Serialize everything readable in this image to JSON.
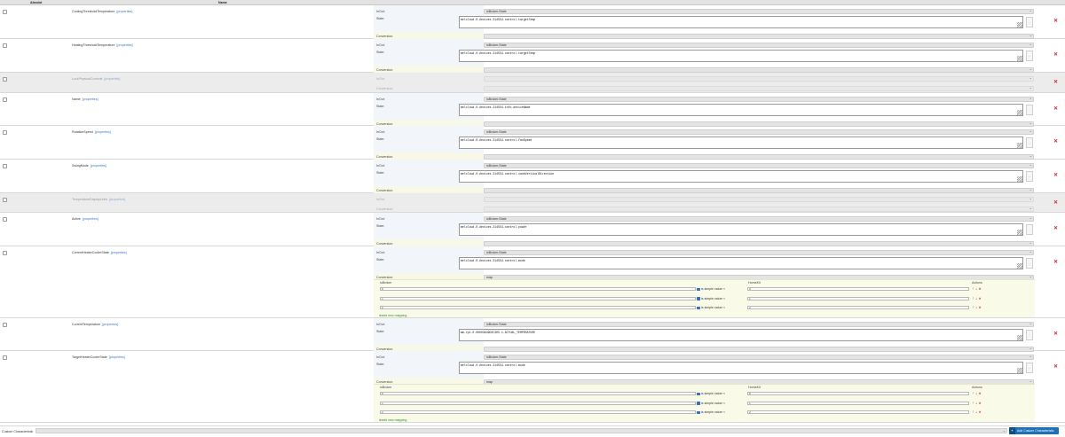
{
  "header": {
    "col_absolute": "Absolut",
    "col_name": "Name"
  },
  "labels": {
    "inout": "InOut:",
    "state": "State:",
    "conversion": "Conversion:",
    "properties_link": "[properties]"
  },
  "options": {
    "iobroker_state": "ioBroker.State",
    "map": "map"
  },
  "rows": [
    {
      "name": "CoolingThresholdTemperature",
      "disabled": false,
      "inout": "ioBroker.State",
      "state": "melcloud.0.devices.214554.control.targetTemp",
      "conversion": ""
    },
    {
      "name": "HeatingThresholdTemperature",
      "disabled": false,
      "inout": "ioBroker.State",
      "state": "melcloud.0.devices.214554.control.targetTemp",
      "conversion": ""
    },
    {
      "name": "LockPhysicalControls",
      "disabled": true,
      "inout": "",
      "state": null,
      "conversion": ""
    },
    {
      "name": "Name",
      "disabled": false,
      "inout": "ioBroker.State",
      "state": "melcloud.0.devices.214554.info.deviceName",
      "conversion": ""
    },
    {
      "name": "RotationSpeed",
      "disabled": false,
      "inout": "ioBroker.State",
      "state": "melcloud.0.devices.214554.control.fanSpeed",
      "conversion": ""
    },
    {
      "name": "SwingMode",
      "disabled": false,
      "inout": "ioBroker.State",
      "state": "melcloud.0.devices.214554.control.vaneVerticalDirection",
      "conversion": ""
    },
    {
      "name": "TemperatureDisplayUnits",
      "disabled": true,
      "inout": "",
      "state": null,
      "conversion": ""
    },
    {
      "name": "Active",
      "disabled": false,
      "inout": "ioBroker.State",
      "state": "melcloud.0.devices.214554.control.power",
      "conversion": ""
    },
    {
      "name": "CurrentHeaterCoolerState",
      "disabled": false,
      "inout": "ioBroker.State",
      "state": "melcloud.0.devices.214554.control.mode",
      "conversion": "map",
      "mapping": {
        "iobroker_head": "ioBroker",
        "homekit_head": "HomeKit",
        "actions_head": "Actions",
        "simple_label": "is simple value",
        "arrow": "⇒",
        "add_label": "add new mapping",
        "entries": [
          {
            "io": "0",
            "hk": "0"
          },
          {
            "io": "1",
            "hk": "1"
          },
          {
            "io": "2",
            "hk": "2"
          }
        ]
      }
    },
    {
      "name": "CurrentTemperature",
      "disabled": false,
      "inout": "ioBroker.State",
      "state": "mm-rpi.0.00003A49D3C3D5.1.ACTUAL_TEMPERATURE",
      "conversion": ""
    },
    {
      "name": "TargetHeaterCoolerState",
      "disabled": false,
      "inout": "ioBroker.State",
      "state": "melcloud.0.devices.214554.control.mode",
      "conversion": "map",
      "mapping": {
        "iobroker_head": "ioBroker",
        "homekit_head": "HomeKit",
        "actions_head": "Actions",
        "simple_label": "is simple value",
        "arrow": "⇒",
        "add_label": "add new mapping",
        "entries": [
          {
            "io": "0",
            "hk": "0"
          },
          {
            "io": "1",
            "hk": "1"
          },
          {
            "io": "2",
            "hk": "2"
          }
        ]
      }
    }
  ],
  "footer": {
    "label": "Custom Characteristic",
    "select_value": "",
    "button_label": "Add Custom Characteristic",
    "button_icon": "plus-icon"
  },
  "colors": {
    "accent": "#1f6fb5",
    "delete": "#d0282a",
    "add_mapping": "#2f8c2f",
    "checkbox_checked": "#2e6fd0"
  }
}
